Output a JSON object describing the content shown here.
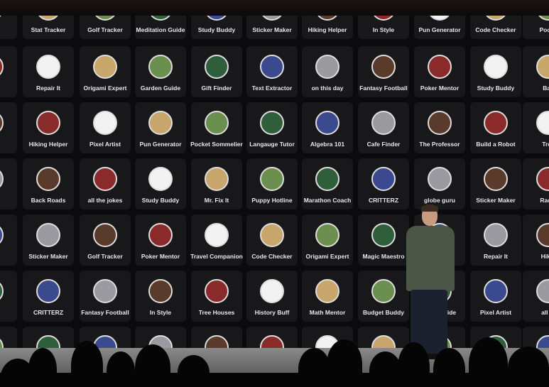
{
  "screen": {
    "accent_colors": {
      "tile": "#18181b",
      "label": "#e8e8e8",
      "background": "#0b0b0d"
    },
    "rows": [
      [
        "u",
        "Stat Tracker",
        "Golf Tracker",
        "Meditation Guide",
        "Study Buddy",
        "Sticker Maker",
        "Hiking Helper",
        "In Style",
        "Pun Generator",
        "Code Checker",
        "Pocke"
      ],
      [
        "gue",
        "Repair It",
        "Origami Expert",
        "Garden Guide",
        "Gift Finder",
        "Text Extractor",
        "on this day",
        "Fantasy Football",
        "Poker Mentor",
        "Study Buddy",
        "Bac"
      ],
      [
        "ctor",
        "Hiking Helper",
        "Pixel Artist",
        "Pun Generator",
        "Pocket Sommelier",
        "Langauge Tutor",
        "Algebra 101",
        "Cafe Finder",
        "The Professor",
        "Build a Robot",
        "Tree"
      ],
      [
        "cker",
        "Back Roads",
        "all the jokes",
        "Study Buddy",
        "Mr. Fix It",
        "Puppy Hotline",
        "Marathon Coach",
        "CRITTERZ",
        "globe guru",
        "Sticker Maker",
        "Racin"
      ],
      [
        "obot",
        "Sticker Maker",
        "Golf Tracker",
        "Poker Mentor",
        "Travel Companion",
        "Code Checker",
        "Origami Expert",
        "Magic Maestro",
        "",
        "Repair It",
        "Hikin"
      ],
      [
        "ntor",
        "CRITTERZ",
        "Fantasy Football",
        "In Style",
        "Tree Houses",
        "History Buff",
        "Math Mentor",
        "Budget Buddy",
        "edi n Guide",
        "Pixel Artist",
        "all th"
      ]
    ],
    "icon_palette": [
      "#f2f2f2",
      "#9a9aa0",
      "#6b8f4e",
      "#8b2a2a",
      "#3b4a8f",
      "#c9a66b",
      "#5a3a2a",
      "#2f5f3a"
    ]
  }
}
